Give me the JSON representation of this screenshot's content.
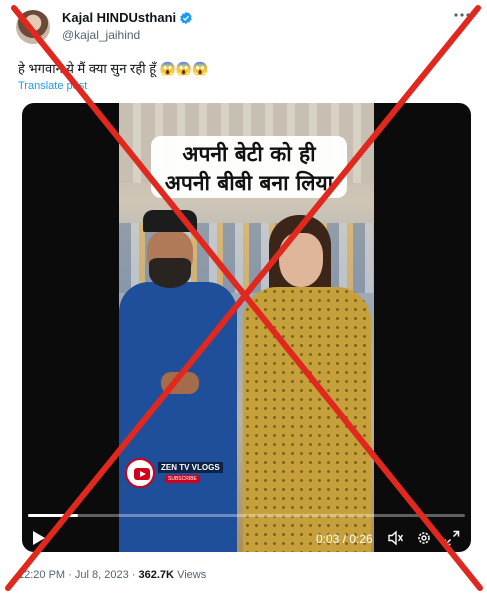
{
  "author": {
    "display_name": "Kajal HINDUsthani",
    "handle": "@kajal_jaihind",
    "verified": true
  },
  "tweet": {
    "text": "हे भगवान ये मैं क्या सुन रही हूँ 😱😱😱",
    "translate_label": "Translate post"
  },
  "video": {
    "caption_line1": "अपनी बेटी को ही",
    "caption_line2": "अपनी बीबी बना लिया",
    "channel_name": "ZEN TV VLOGS",
    "channel_sub": "SUBSCRIBE",
    "current_time": "0:03",
    "duration": "0:26",
    "time_display": "0:03 / 0:26",
    "progress": 0.115
  },
  "meta": {
    "time": "12:20 PM",
    "date": "Jul 8, 2023",
    "views_count": "362.7K",
    "views_label": "Views",
    "separator": "·"
  },
  "colors": {
    "accent": "#1d9bf0",
    "overlay_cross": "#e0281e",
    "muted": "#536471"
  },
  "icons": [
    "verified-icon",
    "more-icon",
    "play-icon",
    "volume-icon",
    "gear-icon",
    "fullscreen-icon"
  ]
}
